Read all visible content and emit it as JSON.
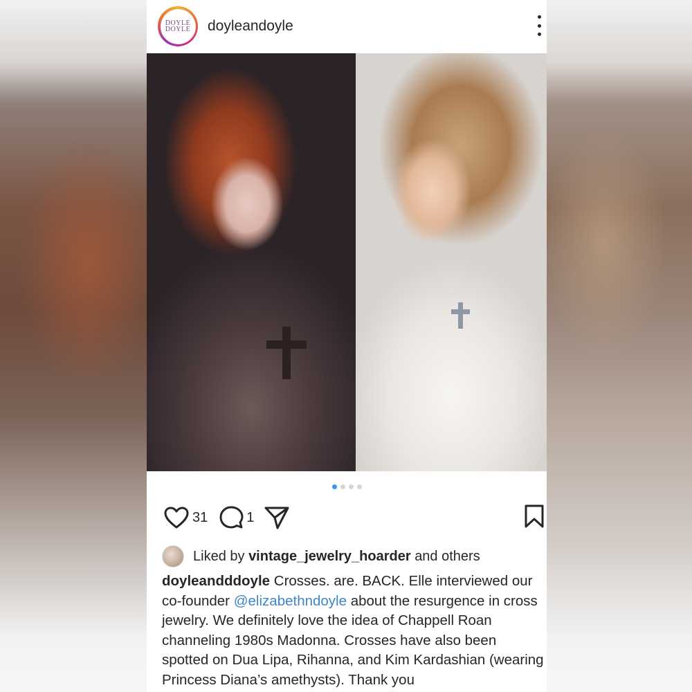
{
  "post": {
    "username": "doyleandoyle",
    "avatar_text_line1": "DOYLE",
    "avatar_text_line2": "DOYLE"
  },
  "carousel": {
    "slide_count": 4,
    "active_index": 0
  },
  "actions": {
    "like_count": "31",
    "comment_count": "1"
  },
  "liked_by": {
    "prefix": "Liked by",
    "user": "vintage_jewelry_hoarder",
    "suffix": "and others"
  },
  "caption": {
    "author": "doyleandddoyle",
    "text_before_mention": "Crosses. are. BACK. Elle interviewed our co-founder",
    "mention": "@elizabethndoyle",
    "text_after_mention": "about the resurgence in cross jewelry. We definitely love the idea of Chappell Roan channeling 1980s Madonna. Crosses have also been spotted on Dua Lipa, Rihanna, and Kim Kardashian (wearing Princess Diana’s amethysts). Thank you"
  },
  "colors": {
    "mention": "#3f86c6",
    "active_dot": "#3897f0",
    "text": "#262626"
  },
  "icons": [
    "heart-icon",
    "comment-icon",
    "share-icon",
    "bookmark-icon",
    "more-icon"
  ]
}
